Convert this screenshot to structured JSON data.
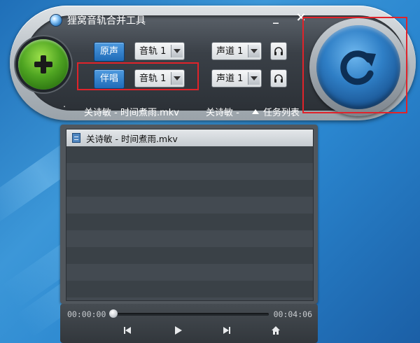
{
  "window": {
    "title": "狸窝音轨合并工具",
    "minimize_label": "_",
    "close_label": "×"
  },
  "tracks": {
    "original": {
      "label": "原声",
      "audio_track": "音轨 1",
      "channel": "声道 1"
    },
    "accompaniment": {
      "label": "伴唱",
      "audio_track": "音轨 1",
      "channel": "声道 1"
    }
  },
  "strip": {
    "dot": "·",
    "file1": "关诗敏 - 时间煮雨.mkv",
    "file2": "关诗敏 -",
    "task_list": "任务列表"
  },
  "list": {
    "rows": [
      {
        "name": "关诗敏 - 时间煮雨.mkv",
        "selected": true
      }
    ]
  },
  "player": {
    "time_current": "00:00:00",
    "time_total": "00:04:06",
    "progress": 0
  },
  "icons": {
    "add": "plus-icon",
    "convert": "refresh-icon",
    "headphone": "headphone-icon",
    "prev": "prev-icon",
    "play": "play-icon",
    "next": "next-icon",
    "home": "home-icon"
  },
  "colors": {
    "accent_blue": "#1f6bb8",
    "add_green": "#4fa522",
    "highlight_red": "#e0232a"
  }
}
